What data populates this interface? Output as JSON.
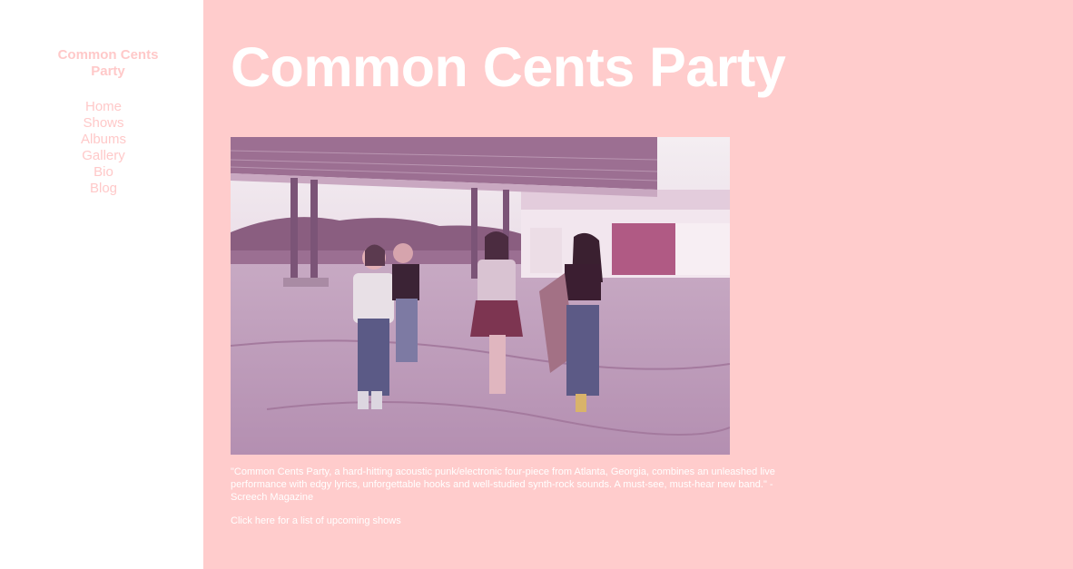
{
  "sidebar": {
    "brand": "Common Cents\nParty",
    "nav": [
      {
        "label": "Home"
      },
      {
        "label": "Shows"
      },
      {
        "label": "Albums"
      },
      {
        "label": "Gallery"
      },
      {
        "label": "Bio"
      },
      {
        "label": "Blog"
      }
    ]
  },
  "main": {
    "title": "Common Cents Party",
    "photo_icon": "band-photo",
    "quote": "\"Common Cents Party, a hard-hitting acoustic punk/electronic four-piece from Atlanta, Georgia, combines an unleashed live performance with edgy lyrics, unforgettable hooks and well-studied synth-rock sounds. A must-see, must-hear new band.\" -Screech Magazine",
    "shows_link": "Click here for a list of upcoming shows"
  },
  "colors": {
    "accent": "#ffcccc",
    "sidebar_text": "#ffc9c9",
    "main_text": "#ffffff"
  }
}
